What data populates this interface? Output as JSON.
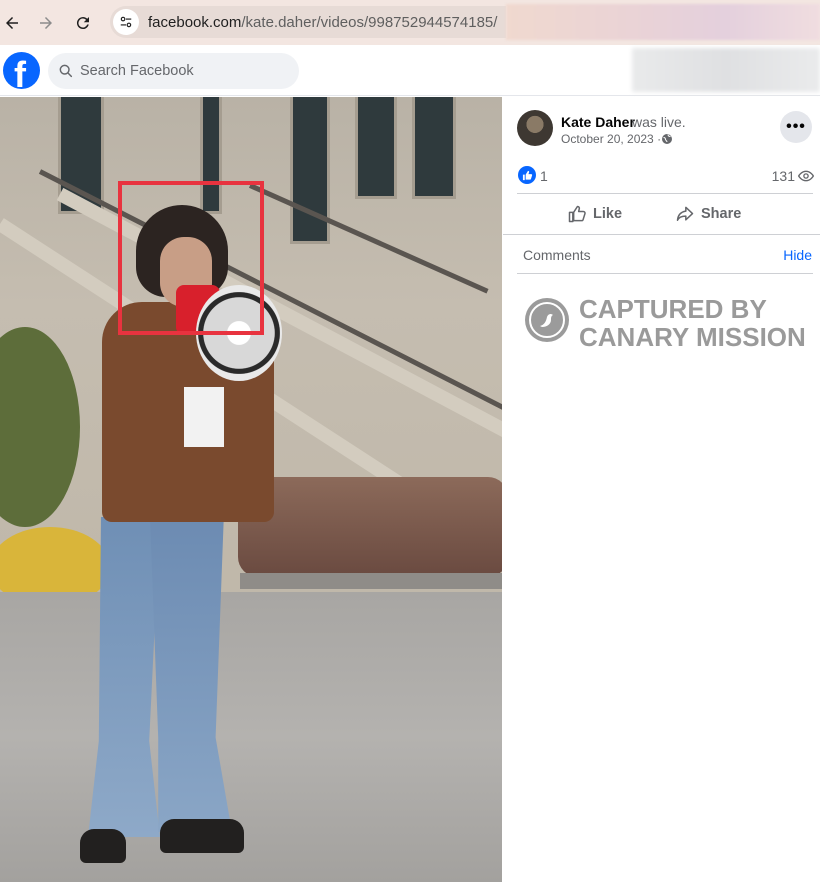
{
  "browser": {
    "url_host": "facebook.com",
    "url_path": "/kate.daher/videos/998752944574185/"
  },
  "fb": {
    "search_placeholder": "Search Facebook"
  },
  "post": {
    "author": "Kate Daher",
    "action": "was live.",
    "date": "October 20, 2023 ·",
    "more": "•••",
    "like_count": "1",
    "view_count": "131",
    "like_label": "Like",
    "share_label": "Share",
    "comments_label": "Comments",
    "hide_label": "Hide"
  },
  "watermark": {
    "line1": "CAPTURED BY",
    "line2": "CANARY MISSION"
  },
  "colors": {
    "fb_blue": "#0866ff",
    "highlight": "#e8333f"
  },
  "icons": [
    "back-icon",
    "forward-icon",
    "reload-icon",
    "site-info-icon",
    "facebook-logo",
    "search-icon",
    "globe-icon",
    "more-icon",
    "like-icon",
    "share-icon",
    "eye-icon"
  ]
}
